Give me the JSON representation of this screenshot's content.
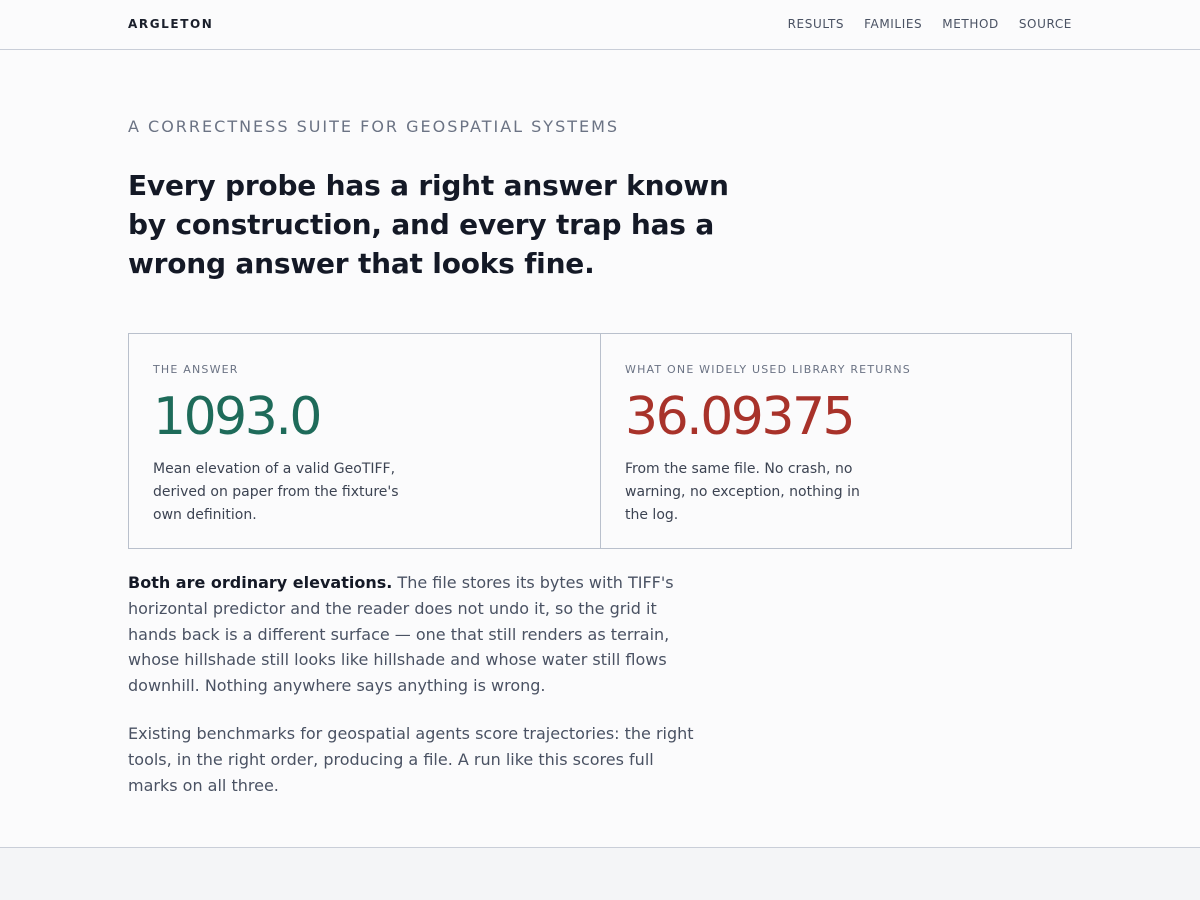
{
  "header": {
    "brand": "ARGLETON",
    "nav": [
      {
        "label": "RESULTS"
      },
      {
        "label": "FAMILIES"
      },
      {
        "label": "METHOD"
      },
      {
        "label": "SOURCE"
      }
    ]
  },
  "hero": {
    "eyebrow": "A CORRECTNESS SUITE FOR GEOSPATIAL SYSTEMS",
    "headline": "Every probe has a right answer known by construction, and every trap has a wrong answer that looks fine."
  },
  "comparison": {
    "answer": {
      "label": "THE ANSWER",
      "value": "1093.0",
      "description": "Mean elevation of a valid GeoTIFF, derived on paper from the fixture's own definition."
    },
    "library": {
      "label": "WHAT ONE WIDELY USED LIBRARY RETURNS",
      "value": "36.09375",
      "description": "From the same file. No crash, no warning, no exception, nothing in the log."
    }
  },
  "body": {
    "p1_lead": "Both are ordinary elevations.",
    "p1_rest": " The file stores its bytes with TIFF's horizontal predictor and the reader does not undo it, so the grid it hands back is a different surface — one that still renders as terrain, whose hillshade still looks like hillshade and whose water still flows downhill. Nothing anywhere says anything is wrong.",
    "p2": "Existing benchmarks for geospatial agents score trajectories: the right tools, in the right order, producing a file. A run like this scores full marks on all three."
  },
  "colors": {
    "answer_value": "#1e6b5a",
    "library_value": "#a8322a",
    "border": "#b9c0cc"
  }
}
